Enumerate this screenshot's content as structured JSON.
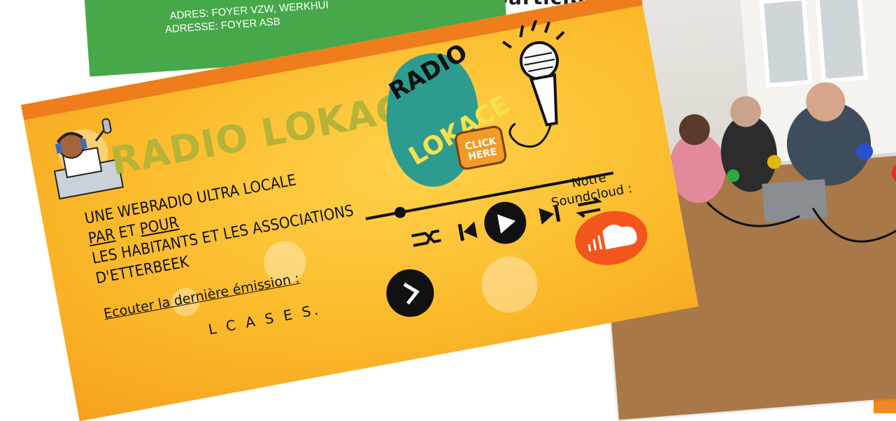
{
  "headline_fragment": "participate à Lokace au",
  "flyer": {
    "address_nl": "ADRES: FOYER VZW, WERKHUI",
    "address_fr": "ADRESSE: FOYER ASB"
  },
  "card": {
    "title": "RADIO LOKACE",
    "logo_text_1": "RADIO",
    "logo_text_2": "LOKACE",
    "tagline_1": "UNE WEBRADIO ULTRA LOCALE",
    "tagline_2_par": "PAR",
    "tagline_2_et": " ET ",
    "tagline_2_pour": "POUR",
    "tagline_3": "LES HABITANTS ET LES ASSOCIATIONS",
    "tagline_4": "D'ETTERBEEK",
    "listen_label": "Ecouter la dernière émission :",
    "bottom_text": "L C A S E S.",
    "soundcloud_label_1": "Notre",
    "soundcloud_label_2": "Soundcloud :",
    "click_here": "CLICK HERE"
  },
  "colors": {
    "orange_strip": "#f28a24",
    "flyer_green": "#47a84a",
    "card_yellow": "#fbb92a",
    "logo_teal": "#2e9b8f",
    "soundcloud_orange": "#f2561d"
  }
}
